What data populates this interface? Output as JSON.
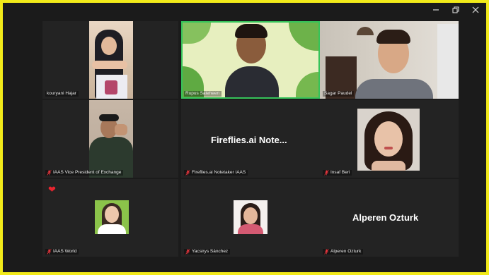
{
  "window": {
    "controls": [
      {
        "name": "minimize",
        "icon": "minimize-icon"
      },
      {
        "name": "restore",
        "icon": "restore-icon"
      },
      {
        "name": "close",
        "icon": "close-icon"
      }
    ]
  },
  "participants": [
    {
      "name": "kouryani Hajar",
      "muted": false
    },
    {
      "name": "Rupus Saleheen",
      "muted": false,
      "active_speaker": true
    },
    {
      "name": "Sagar Paudel",
      "muted": false
    },
    {
      "name": "IAAS Vice President of Exchange",
      "muted": true
    },
    {
      "name": "Fireflies.ai Notetaker IAAS",
      "muted": true,
      "display_text": "Fireflies.ai  Note..."
    },
    {
      "name": "Insaf Beri",
      "muted": true
    },
    {
      "name": "IAAS World",
      "muted": true
    },
    {
      "name": "Yacsirys Sánchez",
      "muted": true
    },
    {
      "name": "Alperen Ozturk",
      "muted": true,
      "display_text": "Alperen Ozturk"
    }
  ],
  "reaction": {
    "icon": "heart-reaction-icon",
    "emoji": "❤"
  },
  "colors": {
    "border": "#f2ea1a",
    "background": "#1b1b1b",
    "tile": "#232323",
    "active_speaker": "#36c35a",
    "muted": "#e8353d"
  }
}
